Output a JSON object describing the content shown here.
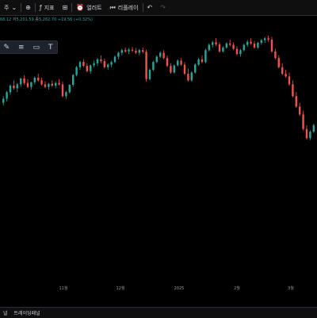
{
  "toolbar": {
    "interval_label": "주",
    "indicators_label": "지표",
    "alerts_label": "얼러트",
    "replay_label": "리플레이"
  },
  "legend": {
    "open_prefix": "",
    "open": "68.12",
    "high_prefix": "저",
    "high": "5,201.59",
    "close_prefix": "종",
    "close": "5,262.70",
    "change": "+19.56 (+0.32%)"
  },
  "bottom": {
    "tab_label": "트레이딩패널",
    "left_label": "널"
  },
  "colors": {
    "up": "#26a69a",
    "down": "#ef5350",
    "background": "#000000"
  },
  "chart_data": {
    "type": "candlestick",
    "x_tick_labels": [
      "11월",
      "12월",
      "2025",
      "2월",
      "3월"
    ],
    "y_range": [
      5200,
      6150
    ],
    "candles": [
      [
        5880,
        5905,
        5870,
        5895
      ],
      [
        5895,
        5925,
        5885,
        5920
      ],
      [
        5920,
        5950,
        5910,
        5945
      ],
      [
        5945,
        5965,
        5930,
        5935
      ],
      [
        5935,
        5955,
        5920,
        5950
      ],
      [
        5950,
        5975,
        5940,
        5972
      ],
      [
        5972,
        5985,
        5948,
        5955
      ],
      [
        5955,
        5970,
        5935,
        5940
      ],
      [
        5940,
        5960,
        5930,
        5958
      ],
      [
        5958,
        5980,
        5950,
        5975
      ],
      [
        5975,
        5990,
        5960,
        5965
      ],
      [
        5965,
        5975,
        5945,
        5950
      ],
      [
        5950,
        5962,
        5935,
        5940
      ],
      [
        5940,
        5955,
        5930,
        5952
      ],
      [
        5952,
        5965,
        5940,
        5945
      ],
      [
        5945,
        5960,
        5935,
        5955
      ],
      [
        5955,
        5970,
        5945,
        5950
      ],
      [
        5950,
        5960,
        5900,
        5905
      ],
      [
        5905,
        5925,
        5895,
        5920
      ],
      [
        5920,
        5950,
        5915,
        5948
      ],
      [
        5948,
        5990,
        5940,
        5985
      ],
      [
        5985,
        6020,
        5980,
        6015
      ],
      [
        6015,
        6040,
        6005,
        6035
      ],
      [
        6035,
        6045,
        6015,
        6020
      ],
      [
        6020,
        6030,
        5995,
        6000
      ],
      [
        6000,
        6025,
        5990,
        6022
      ],
      [
        6022,
        6040,
        6015,
        6030
      ],
      [
        6030,
        6050,
        6020,
        6045
      ],
      [
        6045,
        6060,
        6030,
        6038
      ],
      [
        6038,
        6048,
        6010,
        6015
      ],
      [
        6015,
        6030,
        6005,
        6025
      ],
      [
        6025,
        6040,
        6015,
        6035
      ],
      [
        6035,
        6060,
        6030,
        6055
      ],
      [
        6055,
        6075,
        6045,
        6070
      ],
      [
        6070,
        6085,
        6060,
        6080
      ],
      [
        6080,
        6090,
        6070,
        6075
      ],
      [
        6075,
        6088,
        6065,
        6082
      ],
      [
        6082,
        6092,
        6072,
        6078
      ],
      [
        6078,
        6088,
        6065,
        6070
      ],
      [
        6070,
        6085,
        6060,
        6080
      ],
      [
        6080,
        6090,
        6068,
        6074
      ],
      [
        6074,
        6082,
        5960,
        5970
      ],
      [
        5970,
        6010,
        5965,
        6005
      ],
      [
        6005,
        6040,
        6000,
        6035
      ],
      [
        6035,
        6060,
        6030,
        6055
      ],
      [
        6055,
        6075,
        6050,
        6070
      ],
      [
        6070,
        6080,
        6045,
        6050
      ],
      [
        6050,
        6060,
        6015,
        6020
      ],
      [
        6020,
        6030,
        5990,
        5995
      ],
      [
        5995,
        6025,
        5990,
        6022
      ],
      [
        6022,
        6045,
        6018,
        6040
      ],
      [
        6040,
        6050,
        6020,
        6025
      ],
      [
        6025,
        6035,
        5985,
        5990
      ],
      [
        5990,
        6010,
        5960,
        5965
      ],
      [
        5965,
        6000,
        5960,
        5995
      ],
      [
        5995,
        6030,
        5990,
        6025
      ],
      [
        6025,
        6050,
        6020,
        6045
      ],
      [
        6045,
        6060,
        6030,
        6035
      ],
      [
        6035,
        6085,
        6030,
        6080
      ],
      [
        6080,
        6105,
        6075,
        6100
      ],
      [
        6100,
        6115,
        6090,
        6110
      ],
      [
        6110,
        6125,
        6095,
        6102
      ],
      [
        6102,
        6110,
        6070,
        6075
      ],
      [
        6075,
        6095,
        6070,
        6090
      ],
      [
        6090,
        6110,
        6085,
        6105
      ],
      [
        6105,
        6120,
        6095,
        6100
      ],
      [
        6100,
        6110,
        6080,
        6085
      ],
      [
        6085,
        6095,
        6060,
        6065
      ],
      [
        6065,
        6085,
        6055,
        6080
      ],
      [
        6080,
        6105,
        6075,
        6100
      ],
      [
        6100,
        6118,
        6092,
        6112
      ],
      [
        6112,
        6125,
        6100,
        6105
      ],
      [
        6105,
        6115,
        6085,
        6090
      ],
      [
        6090,
        6112,
        6085,
        6108
      ],
      [
        6108,
        6122,
        6100,
        6118
      ],
      [
        6118,
        6130,
        6108,
        6125
      ],
      [
        6125,
        6135,
        6112,
        6120
      ],
      [
        6120,
        6130,
        6070,
        6075
      ],
      [
        6075,
        6085,
        6045,
        6050
      ],
      [
        6050,
        6060,
        6010,
        6015
      ],
      [
        6015,
        6030,
        5985,
        5990
      ],
      [
        5990,
        6005,
        5975,
        5980
      ],
      [
        5980,
        5995,
        5945,
        5950
      ],
      [
        5950,
        5965,
        5900,
        5905
      ],
      [
        5905,
        5920,
        5860,
        5865
      ],
      [
        5865,
        5880,
        5830,
        5835
      ],
      [
        5835,
        5850,
        5775,
        5780
      ],
      [
        5780,
        5795,
        5740,
        5745
      ],
      [
        5745,
        5775,
        5738,
        5770
      ],
      [
        5770,
        5800,
        5765,
        5795
      ]
    ]
  }
}
